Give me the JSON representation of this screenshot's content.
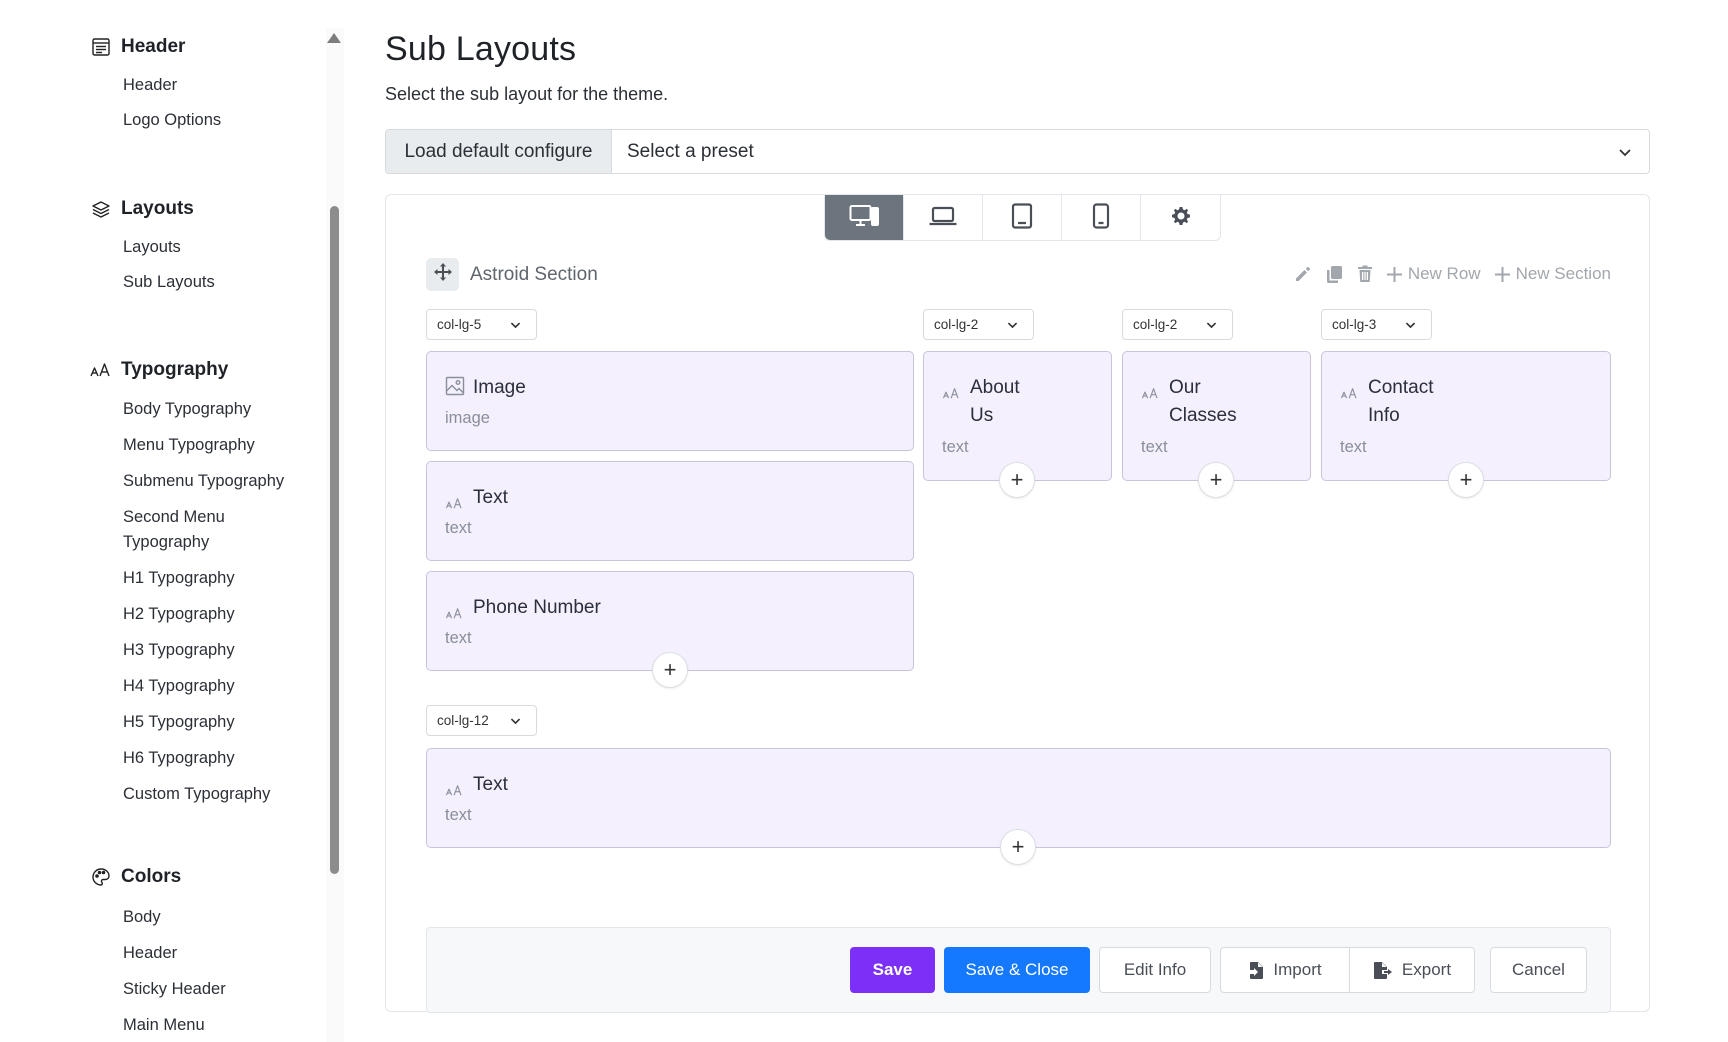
{
  "sidebar": {
    "groups": [
      {
        "title": "Header",
        "icon": "header-icon",
        "items": [
          "Header",
          "Logo Options"
        ]
      },
      {
        "title": "Layouts",
        "icon": "layers-icon",
        "items": [
          "Layouts",
          "Sub Layouts"
        ]
      },
      {
        "title": "Typography",
        "icon": "typography-icon",
        "items": [
          "Body Typography",
          "Menu Typography",
          "Submenu Typography",
          "Second Menu Typography",
          "H1 Typography",
          "H2 Typography",
          "H3 Typography",
          "H4 Typography",
          "H5 Typography",
          "H6 Typography",
          "Custom Typography"
        ]
      },
      {
        "title": "Colors",
        "icon": "palette-icon",
        "items": [
          "Body",
          "Header",
          "Sticky Header",
          "Main Menu"
        ]
      }
    ]
  },
  "main": {
    "title": "Sub Layouts",
    "subtitle": "Select the sub layout for the theme.",
    "load_default_label": "Load default configure",
    "preset_placeholder": "Select a preset",
    "devices": [
      {
        "name": "desktop-icon",
        "active": true
      },
      {
        "name": "laptop-icon",
        "active": false
      },
      {
        "name": "tablet-icon",
        "active": false
      },
      {
        "name": "mobile-icon",
        "active": false
      },
      {
        "name": "gear-icon",
        "active": false
      }
    ],
    "section": {
      "name": "Astroid Section",
      "new_row_label": "New Row",
      "new_section_label": "New Section"
    },
    "columns": [
      {
        "class": "col-lg-5",
        "addons": [
          {
            "title": "Image",
            "type": "image",
            "icon": "image-icon"
          },
          {
            "title": "Text",
            "type": "text",
            "icon": "text-icon"
          },
          {
            "title": "Phone Number",
            "type": "text",
            "icon": "text-icon"
          }
        ]
      },
      {
        "class": "col-lg-2",
        "addons": [
          {
            "title": "About Us",
            "type": "text",
            "icon": "text-icon"
          }
        ]
      },
      {
        "class": "col-lg-2",
        "addons": [
          {
            "title": "Our Classes",
            "type": "text",
            "icon": "text-icon"
          }
        ]
      },
      {
        "class": "col-lg-3",
        "addons": [
          {
            "title": "Contact Info",
            "type": "text",
            "icon": "text-icon"
          }
        ]
      },
      {
        "class": "col-lg-12",
        "addons": [
          {
            "title": "Text",
            "type": "text",
            "icon": "text-icon"
          }
        ]
      }
    ],
    "footer": {
      "save": "Save",
      "save_close": "Save & Close",
      "edit_info": "Edit Info",
      "import": "Import",
      "export": "Export",
      "cancel": "Cancel"
    },
    "colors": {
      "save": "#7b2ff7",
      "save_close": "#1479ff",
      "addon_bg": "#f4f0fe",
      "device_active": "#6c757d"
    }
  }
}
